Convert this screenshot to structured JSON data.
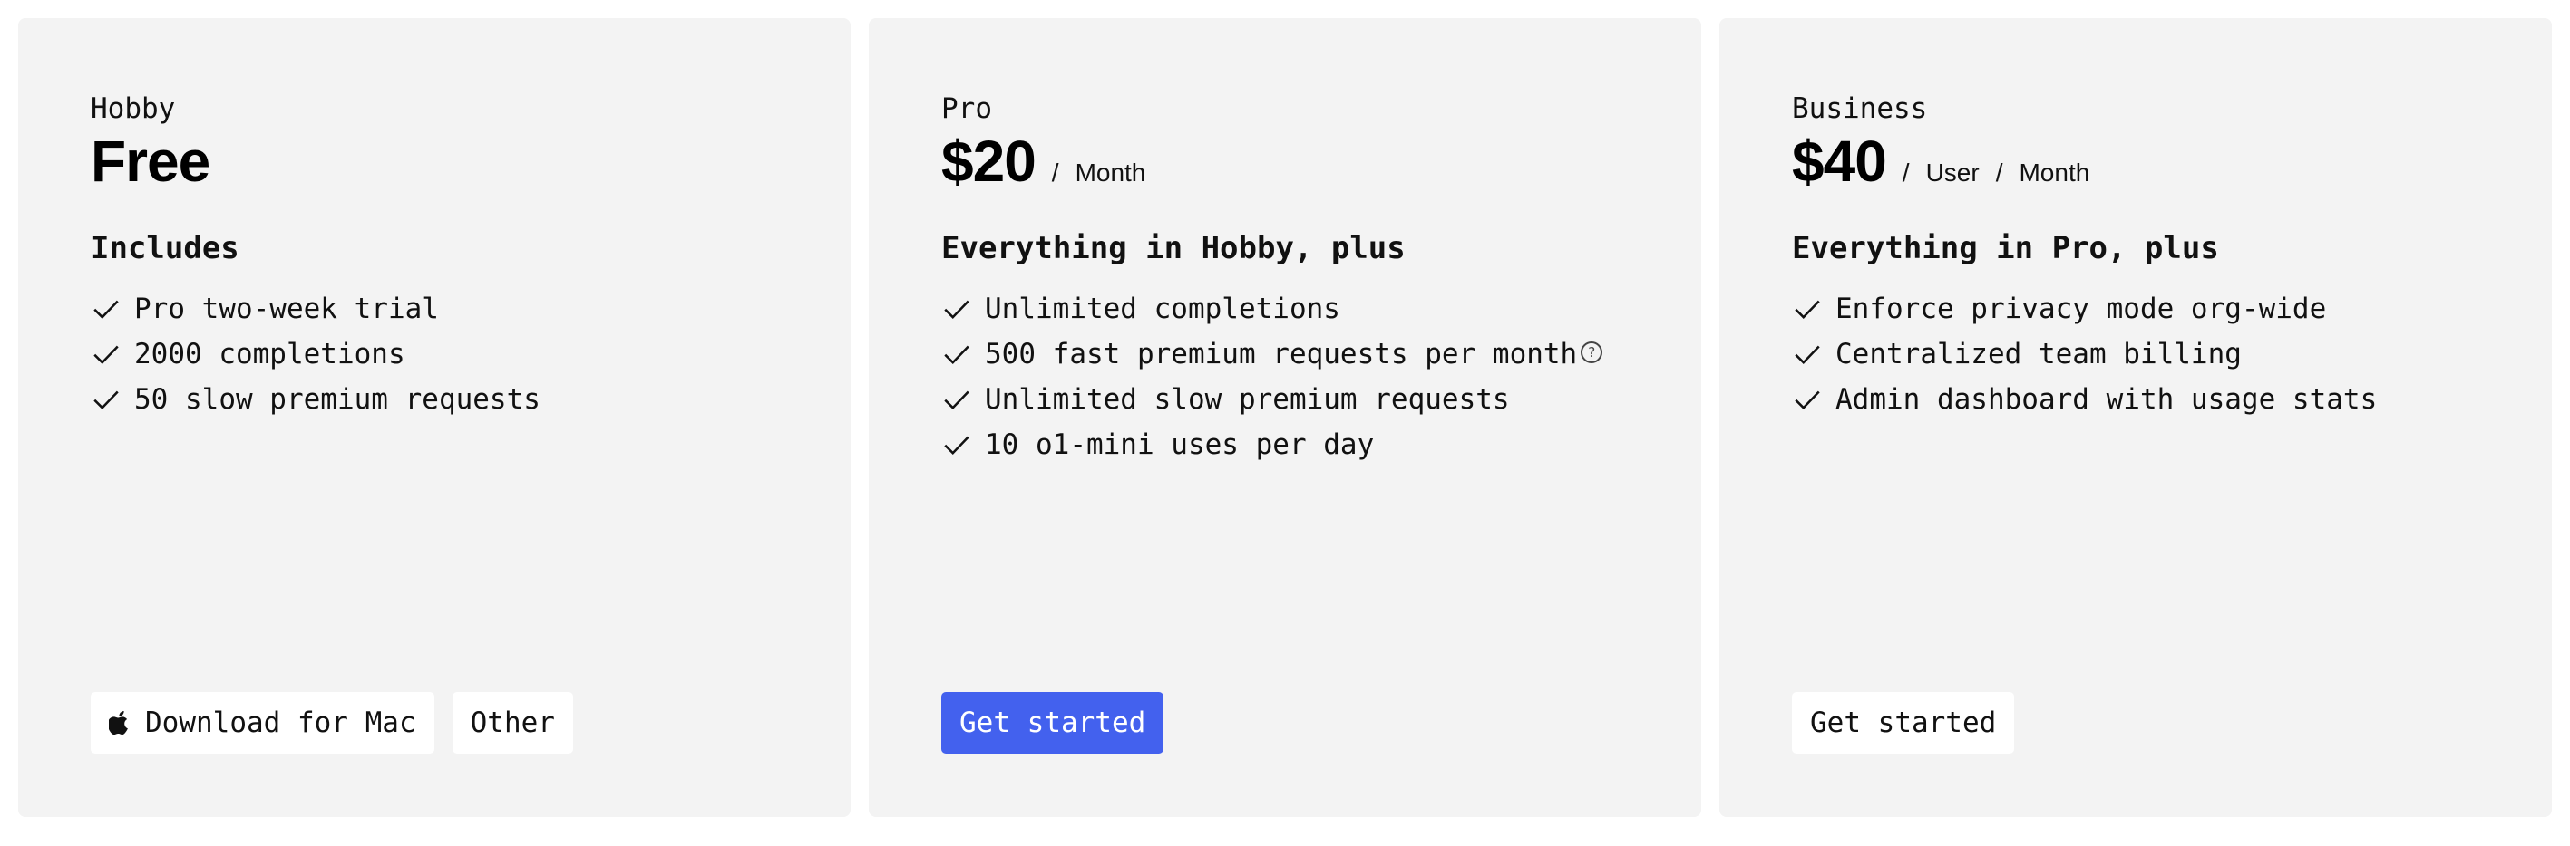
{
  "plans": [
    {
      "tier": "Hobby",
      "price": "Free",
      "units": [],
      "includes_title": "Includes",
      "features": [
        "Pro two-week trial",
        "2000 completions",
        "50 slow premium requests"
      ],
      "buttons": [
        {
          "label": "Download for Mac",
          "icon": "apple-icon",
          "style": "secondary"
        },
        {
          "label": "Other",
          "style": "secondary"
        }
      ]
    },
    {
      "tier": "Pro",
      "price": "$20",
      "units": [
        "Month"
      ],
      "includes_title": "Everything in Hobby, plus",
      "features": [
        "Unlimited completions",
        "500 fast premium requests per month",
        "Unlimited slow premium requests",
        "10 o1-mini uses per day"
      ],
      "help_marker": "?",
      "buttons": [
        {
          "label": "Get started",
          "style": "primary"
        }
      ]
    },
    {
      "tier": "Business",
      "price": "$40",
      "units": [
        "User",
        "Month"
      ],
      "includes_title": "Everything in Pro, plus",
      "features": [
        "Enforce privacy mode org-wide",
        "Centralized team billing",
        "Admin dashboard with usage stats"
      ],
      "buttons": [
        {
          "label": "Get started",
          "style": "secondary"
        }
      ]
    }
  ],
  "price_separator": "/",
  "colors": {
    "card_bg": "#f3f3f3",
    "primary_button": "#4361ee",
    "secondary_button": "#ffffff"
  }
}
